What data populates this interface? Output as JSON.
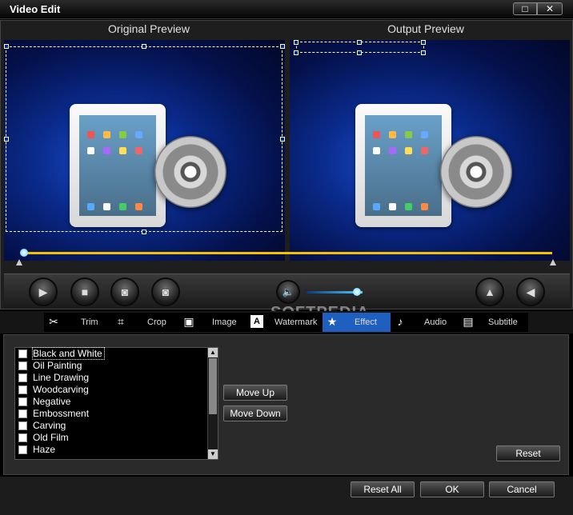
{
  "window": {
    "title": "Video Edit",
    "maximize_glyph": "□",
    "close_glyph": "✕"
  },
  "preview": {
    "original_label": "Original Preview",
    "output_label": "Output Preview"
  },
  "player": {
    "volume_fraction": 0.9,
    "timeline_progress": 0.0,
    "buttons": {
      "play": "▶",
      "stop": "■",
      "prev": "◙",
      "next": "◙",
      "volume": "🔈",
      "flip": "▲",
      "rotate": "◀"
    }
  },
  "tabs": [
    {
      "label": "Trim",
      "icon": "scissors-icon",
      "glyph": "✂"
    },
    {
      "label": "Crop",
      "icon": "crop-icon",
      "glyph": "⌗"
    },
    {
      "label": "Image",
      "icon": "image-icon",
      "glyph": "▣"
    },
    {
      "label": "Watermark",
      "icon": "watermark-icon",
      "glyph": "A"
    },
    {
      "label": "Effect",
      "icon": "star-icon",
      "glyph": "★"
    },
    {
      "label": "Audio",
      "icon": "music-note-icon",
      "glyph": "♪"
    },
    {
      "label": "Subtitle",
      "icon": "subtitle-icon",
      "glyph": "▤"
    }
  ],
  "active_tab": "Effect",
  "effects": {
    "items": [
      {
        "label": "Black and White",
        "checked": false,
        "selected": true
      },
      {
        "label": "Oil Painting",
        "checked": false
      },
      {
        "label": "Line Drawing",
        "checked": false
      },
      {
        "label": "Woodcarving",
        "checked": false
      },
      {
        "label": "Negative",
        "checked": false
      },
      {
        "label": "Embossment",
        "checked": false
      },
      {
        "label": "Carving",
        "checked": false
      },
      {
        "label": "Old Film",
        "checked": false
      },
      {
        "label": "Haze",
        "checked": false
      }
    ],
    "move_up": "Move Up",
    "move_down": "Move Down",
    "reset": "Reset"
  },
  "footer": {
    "reset_all": "Reset All",
    "ok": "OK",
    "cancel": "Cancel"
  },
  "watermark_text": "SOFTPEDIA",
  "colors": {
    "accent": "#1f5fc0",
    "timeline": "#f5c000",
    "slider": "#4dd0ff"
  }
}
